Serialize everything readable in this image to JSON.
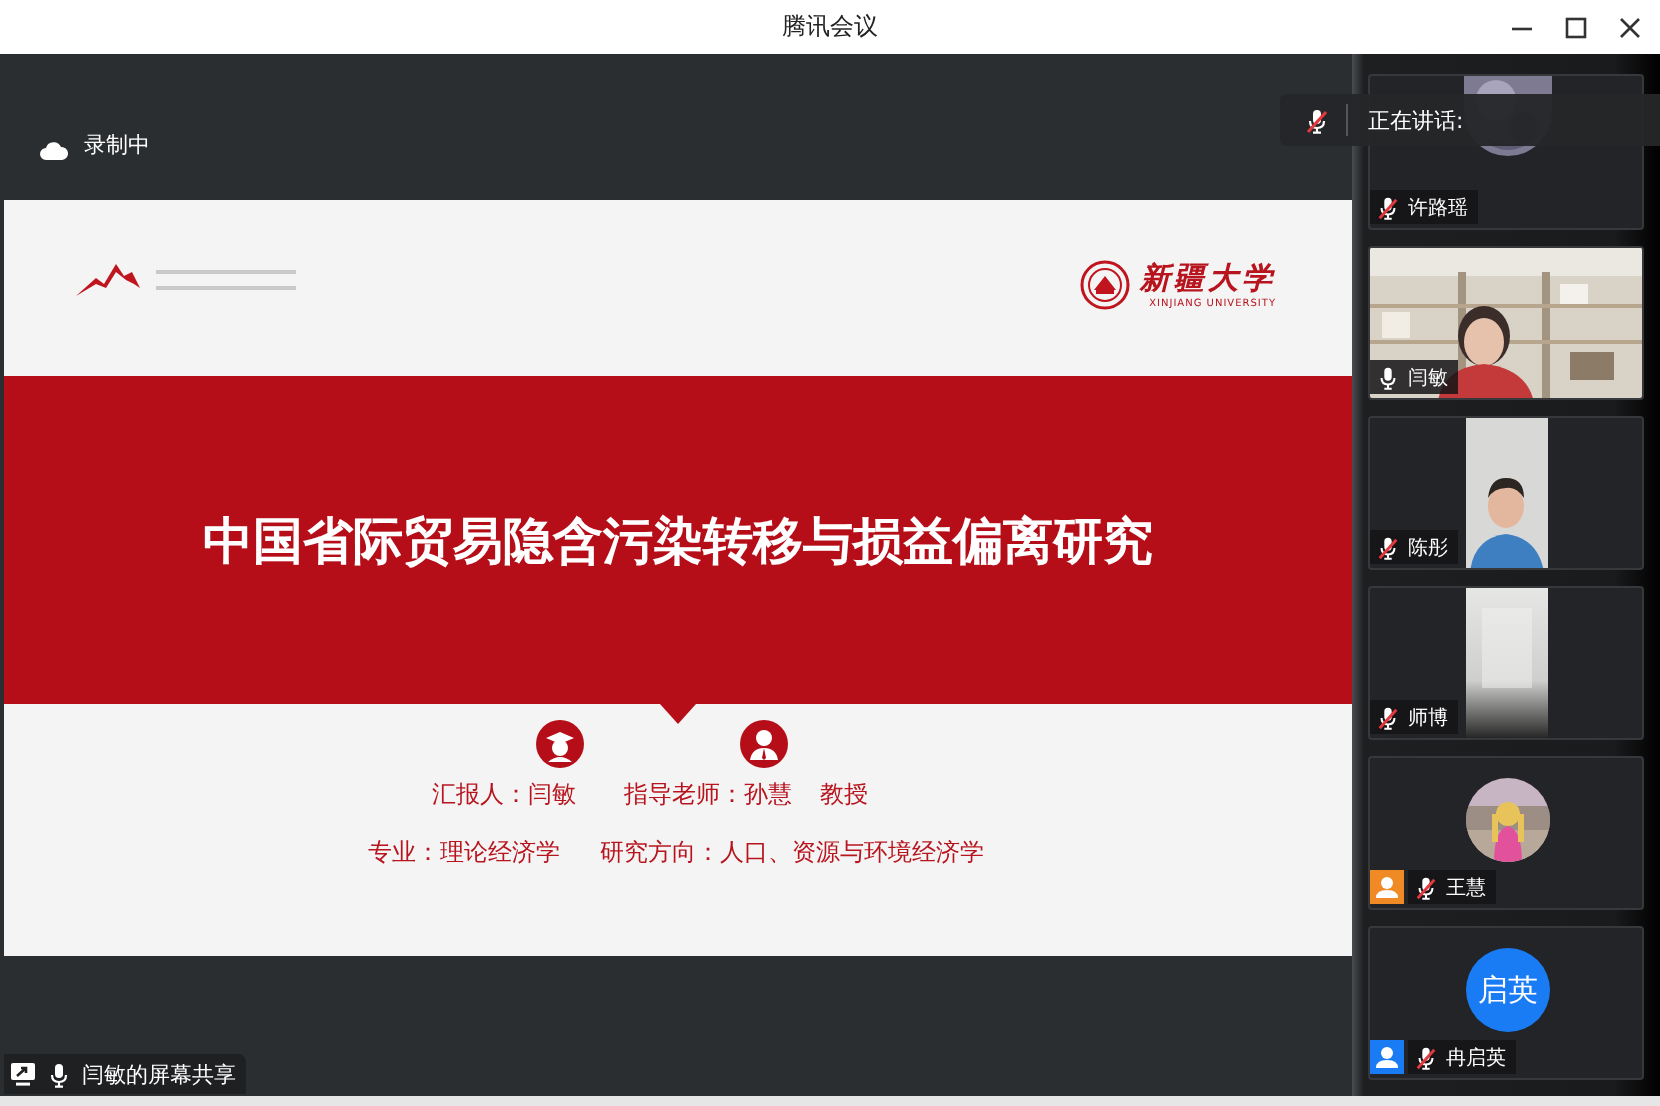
{
  "window": {
    "title": "腾讯会议"
  },
  "recording": {
    "label": "录制中"
  },
  "speaking": {
    "label": "正在讲话:",
    "muted": true
  },
  "slide": {
    "university": {
      "name": "新疆大学",
      "name_en": "XINJIANG UNIVERSITY"
    },
    "title": "中国省际贸易隐含污染转移与损益偏离研究",
    "presenter": "汇报人：闫敏",
    "advisor": "指导老师：孙慧",
    "advisor_title": "教授",
    "major": "专业：理论经济学",
    "direction": "研究方向：人口、资源与环境经济学"
  },
  "participants": [
    {
      "name": "许路瑶",
      "muted": true,
      "kind": "top_picture"
    },
    {
      "name": "闫敏",
      "muted": false,
      "kind": "video"
    },
    {
      "name": "陈彤",
      "muted": true,
      "kind": "narrow_video"
    },
    {
      "name": "师博",
      "muted": true,
      "kind": "narrow_blank"
    },
    {
      "name": "王慧",
      "muted": true,
      "kind": "avatar_picture",
      "color": "#f08a24"
    },
    {
      "name": "冉启英",
      "muted": true,
      "kind": "avatar_initials",
      "initials": "启英",
      "color": "#1a7cf5"
    }
  ],
  "share": {
    "label": "闫敏的屏幕共享",
    "muted": false
  }
}
